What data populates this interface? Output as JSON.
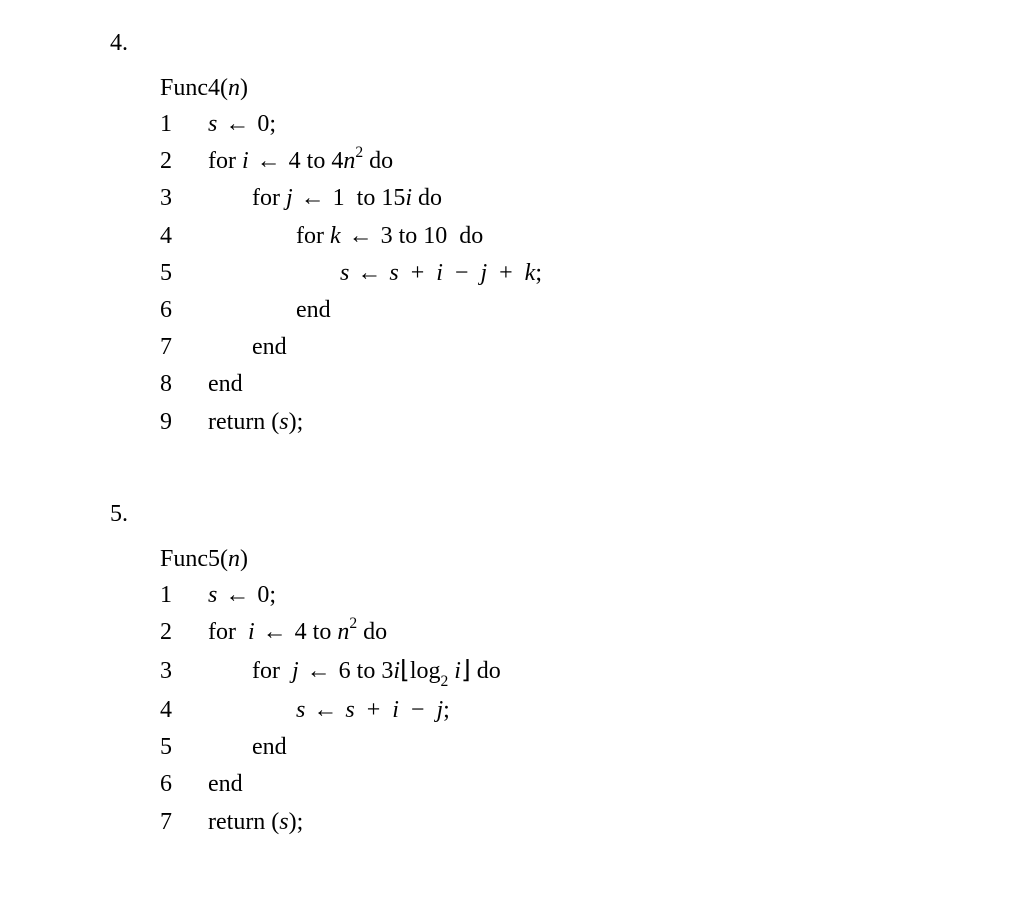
{
  "problems": [
    {
      "number": "4.",
      "title_name": "Func4",
      "title_arg": "n",
      "lines": [
        {
          "num": "1",
          "indent": 0,
          "tokens": [
            {
              "t": "it",
              "v": "s"
            },
            {
              "t": "arr",
              "v": " ← "
            },
            {
              "t": "up",
              "v": "0;"
            }
          ]
        },
        {
          "num": "2",
          "indent": 0,
          "tokens": [
            {
              "t": "up",
              "v": "for "
            },
            {
              "t": "it",
              "v": "i"
            },
            {
              "t": "arr",
              "v": " ← "
            },
            {
              "t": "up",
              "v": "4 to 4"
            },
            {
              "t": "it",
              "v": "n"
            },
            {
              "t": "sup",
              "v": "2"
            },
            {
              "t": "up",
              "v": " do"
            }
          ]
        },
        {
          "num": "3",
          "indent": 1,
          "tokens": [
            {
              "t": "up",
              "v": "for "
            },
            {
              "t": "it",
              "v": "j"
            },
            {
              "t": "arr",
              "v": " ← "
            },
            {
              "t": "up",
              "v": "1  to 15"
            },
            {
              "t": "it",
              "v": "i"
            },
            {
              "t": "up",
              "v": " do"
            }
          ]
        },
        {
          "num": "4",
          "indent": 2,
          "tokens": [
            {
              "t": "up",
              "v": "for "
            },
            {
              "t": "it",
              "v": "k"
            },
            {
              "t": "arr",
              "v": " ← "
            },
            {
              "t": "up",
              "v": "3 to 10  do"
            }
          ]
        },
        {
          "num": "5",
          "indent": 3,
          "tokens": [
            {
              "t": "it",
              "v": "s"
            },
            {
              "t": "arr",
              "v": " ← "
            },
            {
              "t": "it",
              "v": "s"
            },
            {
              "t": "up",
              "v": "  +  "
            },
            {
              "t": "it",
              "v": "i"
            },
            {
              "t": "up",
              "v": "  −  "
            },
            {
              "t": "it",
              "v": "j"
            },
            {
              "t": "up",
              "v": "  +  "
            },
            {
              "t": "it",
              "v": "k"
            },
            {
              "t": "up",
              "v": ";"
            }
          ]
        },
        {
          "num": "6",
          "indent": 2,
          "tokens": [
            {
              "t": "up",
              "v": "end"
            }
          ]
        },
        {
          "num": "7",
          "indent": 1,
          "tokens": [
            {
              "t": "up",
              "v": "end"
            }
          ]
        },
        {
          "num": "8",
          "indent": 0,
          "tokens": [
            {
              "t": "up",
              "v": "end"
            }
          ]
        },
        {
          "num": "9",
          "indent": 0,
          "tokens": [
            {
              "t": "up",
              "v": "return ("
            },
            {
              "t": "it",
              "v": "s"
            },
            {
              "t": "up",
              "v": ");"
            }
          ]
        }
      ]
    },
    {
      "number": "5.",
      "title_name": "Func5",
      "title_arg": "n",
      "lines": [
        {
          "num": "1",
          "indent": 0,
          "tokens": [
            {
              "t": "it",
              "v": "s"
            },
            {
              "t": "arr",
              "v": " ← "
            },
            {
              "t": "up",
              "v": "0;"
            }
          ]
        },
        {
          "num": "2",
          "indent": 0,
          "tokens": [
            {
              "t": "up",
              "v": "for  "
            },
            {
              "t": "it",
              "v": "i"
            },
            {
              "t": "arr",
              "v": " ← "
            },
            {
              "t": "up",
              "v": "4 to "
            },
            {
              "t": "it",
              "v": "n"
            },
            {
              "t": "sup",
              "v": "2"
            },
            {
              "t": "up",
              "v": " do"
            }
          ]
        },
        {
          "num": "3",
          "indent": 1,
          "tokens": [
            {
              "t": "up",
              "v": "for  "
            },
            {
              "t": "it",
              "v": "j"
            },
            {
              "t": "arr",
              "v": " ← "
            },
            {
              "t": "up",
              "v": "6 to 3"
            },
            {
              "t": "it",
              "v": "i"
            },
            {
              "t": "floorL",
              "v": "⌊"
            },
            {
              "t": "up",
              "v": "log"
            },
            {
              "t": "sub",
              "v": "2"
            },
            {
              "t": "up",
              "v": " "
            },
            {
              "t": "it",
              "v": "i"
            },
            {
              "t": "floorR",
              "v": "⌋"
            },
            {
              "t": "up",
              "v": " do"
            }
          ]
        },
        {
          "num": "4",
          "indent": 2,
          "tokens": [
            {
              "t": "it",
              "v": "s"
            },
            {
              "t": "arr",
              "v": " ← "
            },
            {
              "t": "it",
              "v": "s"
            },
            {
              "t": "up",
              "v": "  +  "
            },
            {
              "t": "it",
              "v": "i"
            },
            {
              "t": "up",
              "v": "  −  "
            },
            {
              "t": "it",
              "v": "j"
            },
            {
              "t": "up",
              "v": ";"
            }
          ]
        },
        {
          "num": "5",
          "indent": 1,
          "tokens": [
            {
              "t": "up",
              "v": "end"
            }
          ]
        },
        {
          "num": "6",
          "indent": 0,
          "tokens": [
            {
              "t": "up",
              "v": "end"
            }
          ]
        },
        {
          "num": "7",
          "indent": 0,
          "tokens": [
            {
              "t": "up",
              "v": "return ("
            },
            {
              "t": "it",
              "v": "s"
            },
            {
              "t": "up",
              "v": ");"
            }
          ]
        }
      ]
    }
  ]
}
